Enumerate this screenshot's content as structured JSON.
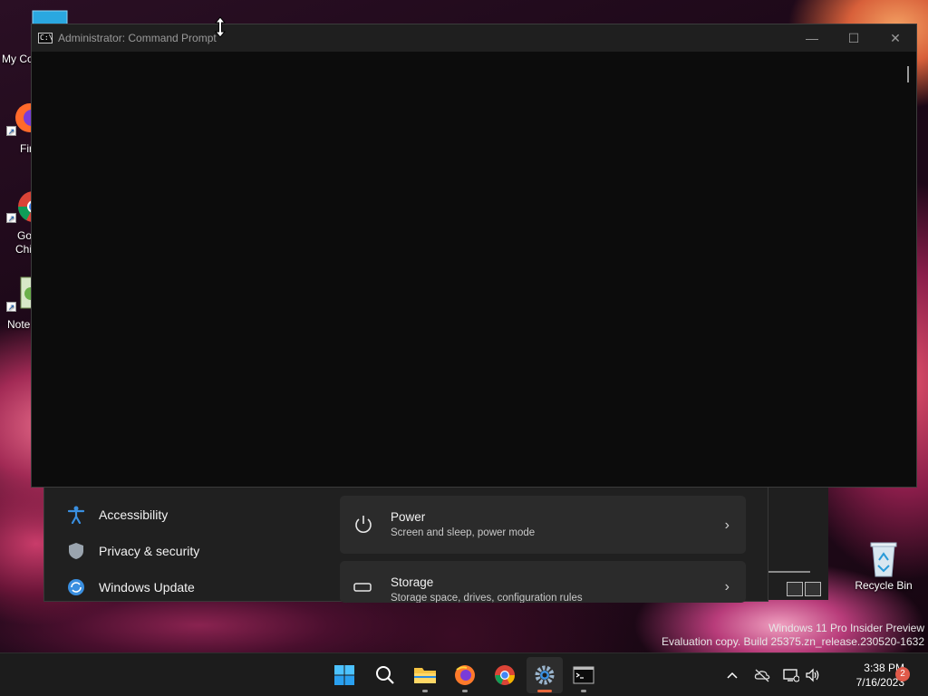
{
  "desktop": {
    "icons": [
      {
        "label": "My Co"
      },
      {
        "label": "Fir"
      },
      {
        "label": "Go",
        "label2": "Chi"
      },
      {
        "label": "Note"
      },
      {
        "label": "Recycle Bin"
      }
    ]
  },
  "cmd_window": {
    "title": "Administrator:  Command Prompt",
    "minimize": "—",
    "maximize": "☐",
    "close": "✕"
  },
  "settings": {
    "nav": [
      {
        "label": "Accessibility",
        "icon": "accessibility-icon"
      },
      {
        "label": "Privacy & security",
        "icon": "shield-icon"
      },
      {
        "label": "Windows Update",
        "icon": "update-icon"
      }
    ],
    "cards": [
      {
        "title": "Power",
        "subtitle": "Screen and sleep, power mode",
        "icon": "power-icon"
      },
      {
        "title": "Storage",
        "subtitle": "Storage space, drives, configuration rules",
        "icon": "storage-icon"
      }
    ]
  },
  "watermark": {
    "line1": "Windows 11 Pro Insider Preview",
    "line2": "Evaluation copy. Build 25375.zn_release.230520-1632"
  },
  "taskbar": {
    "apps": [
      "start-icon",
      "search-icon",
      "file-explorer-icon",
      "firefox-icon",
      "chrome-icon",
      "settings-icon",
      "terminal-icon"
    ],
    "active": "settings-icon",
    "time": "3:38 PM",
    "date": "7/16/2023",
    "notifications": "2"
  },
  "colors": {
    "accent": "#e8683c",
    "windows_update_blue": "#3a8fe0",
    "console_bg": "#0c0c0c"
  }
}
